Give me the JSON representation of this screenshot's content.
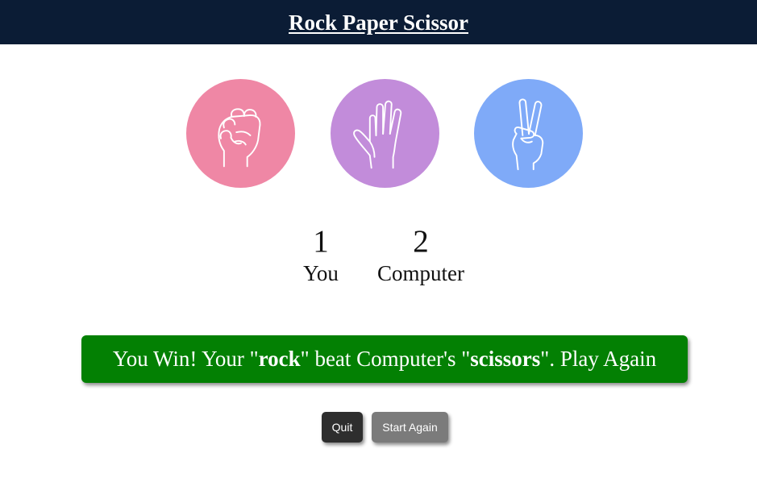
{
  "header": {
    "title": "Rock Paper Scissor"
  },
  "choices": [
    {
      "name": "rock",
      "icon": "fist-icon",
      "color": "#ef87a5"
    },
    {
      "name": "paper",
      "icon": "open-hand-icon",
      "color": "#c28cda"
    },
    {
      "name": "scissors",
      "icon": "peace-hand-icon",
      "color": "#7faaf8"
    }
  ],
  "scoreboard": {
    "user_score": "1",
    "user_label": "You",
    "computer_score": "2",
    "computer_label": "Computer"
  },
  "result": {
    "prefix": "You Win! Your \"",
    "user_choice": "rock",
    "middle": "\" beat Computer's \"",
    "computer_choice": "scissors",
    "suffix": "\". Play Again",
    "color": "#038003"
  },
  "buttons": {
    "quit_label": "Quit",
    "start_again_label": "Start Again"
  },
  "colors": {
    "header_bg": "#0b1c35"
  }
}
